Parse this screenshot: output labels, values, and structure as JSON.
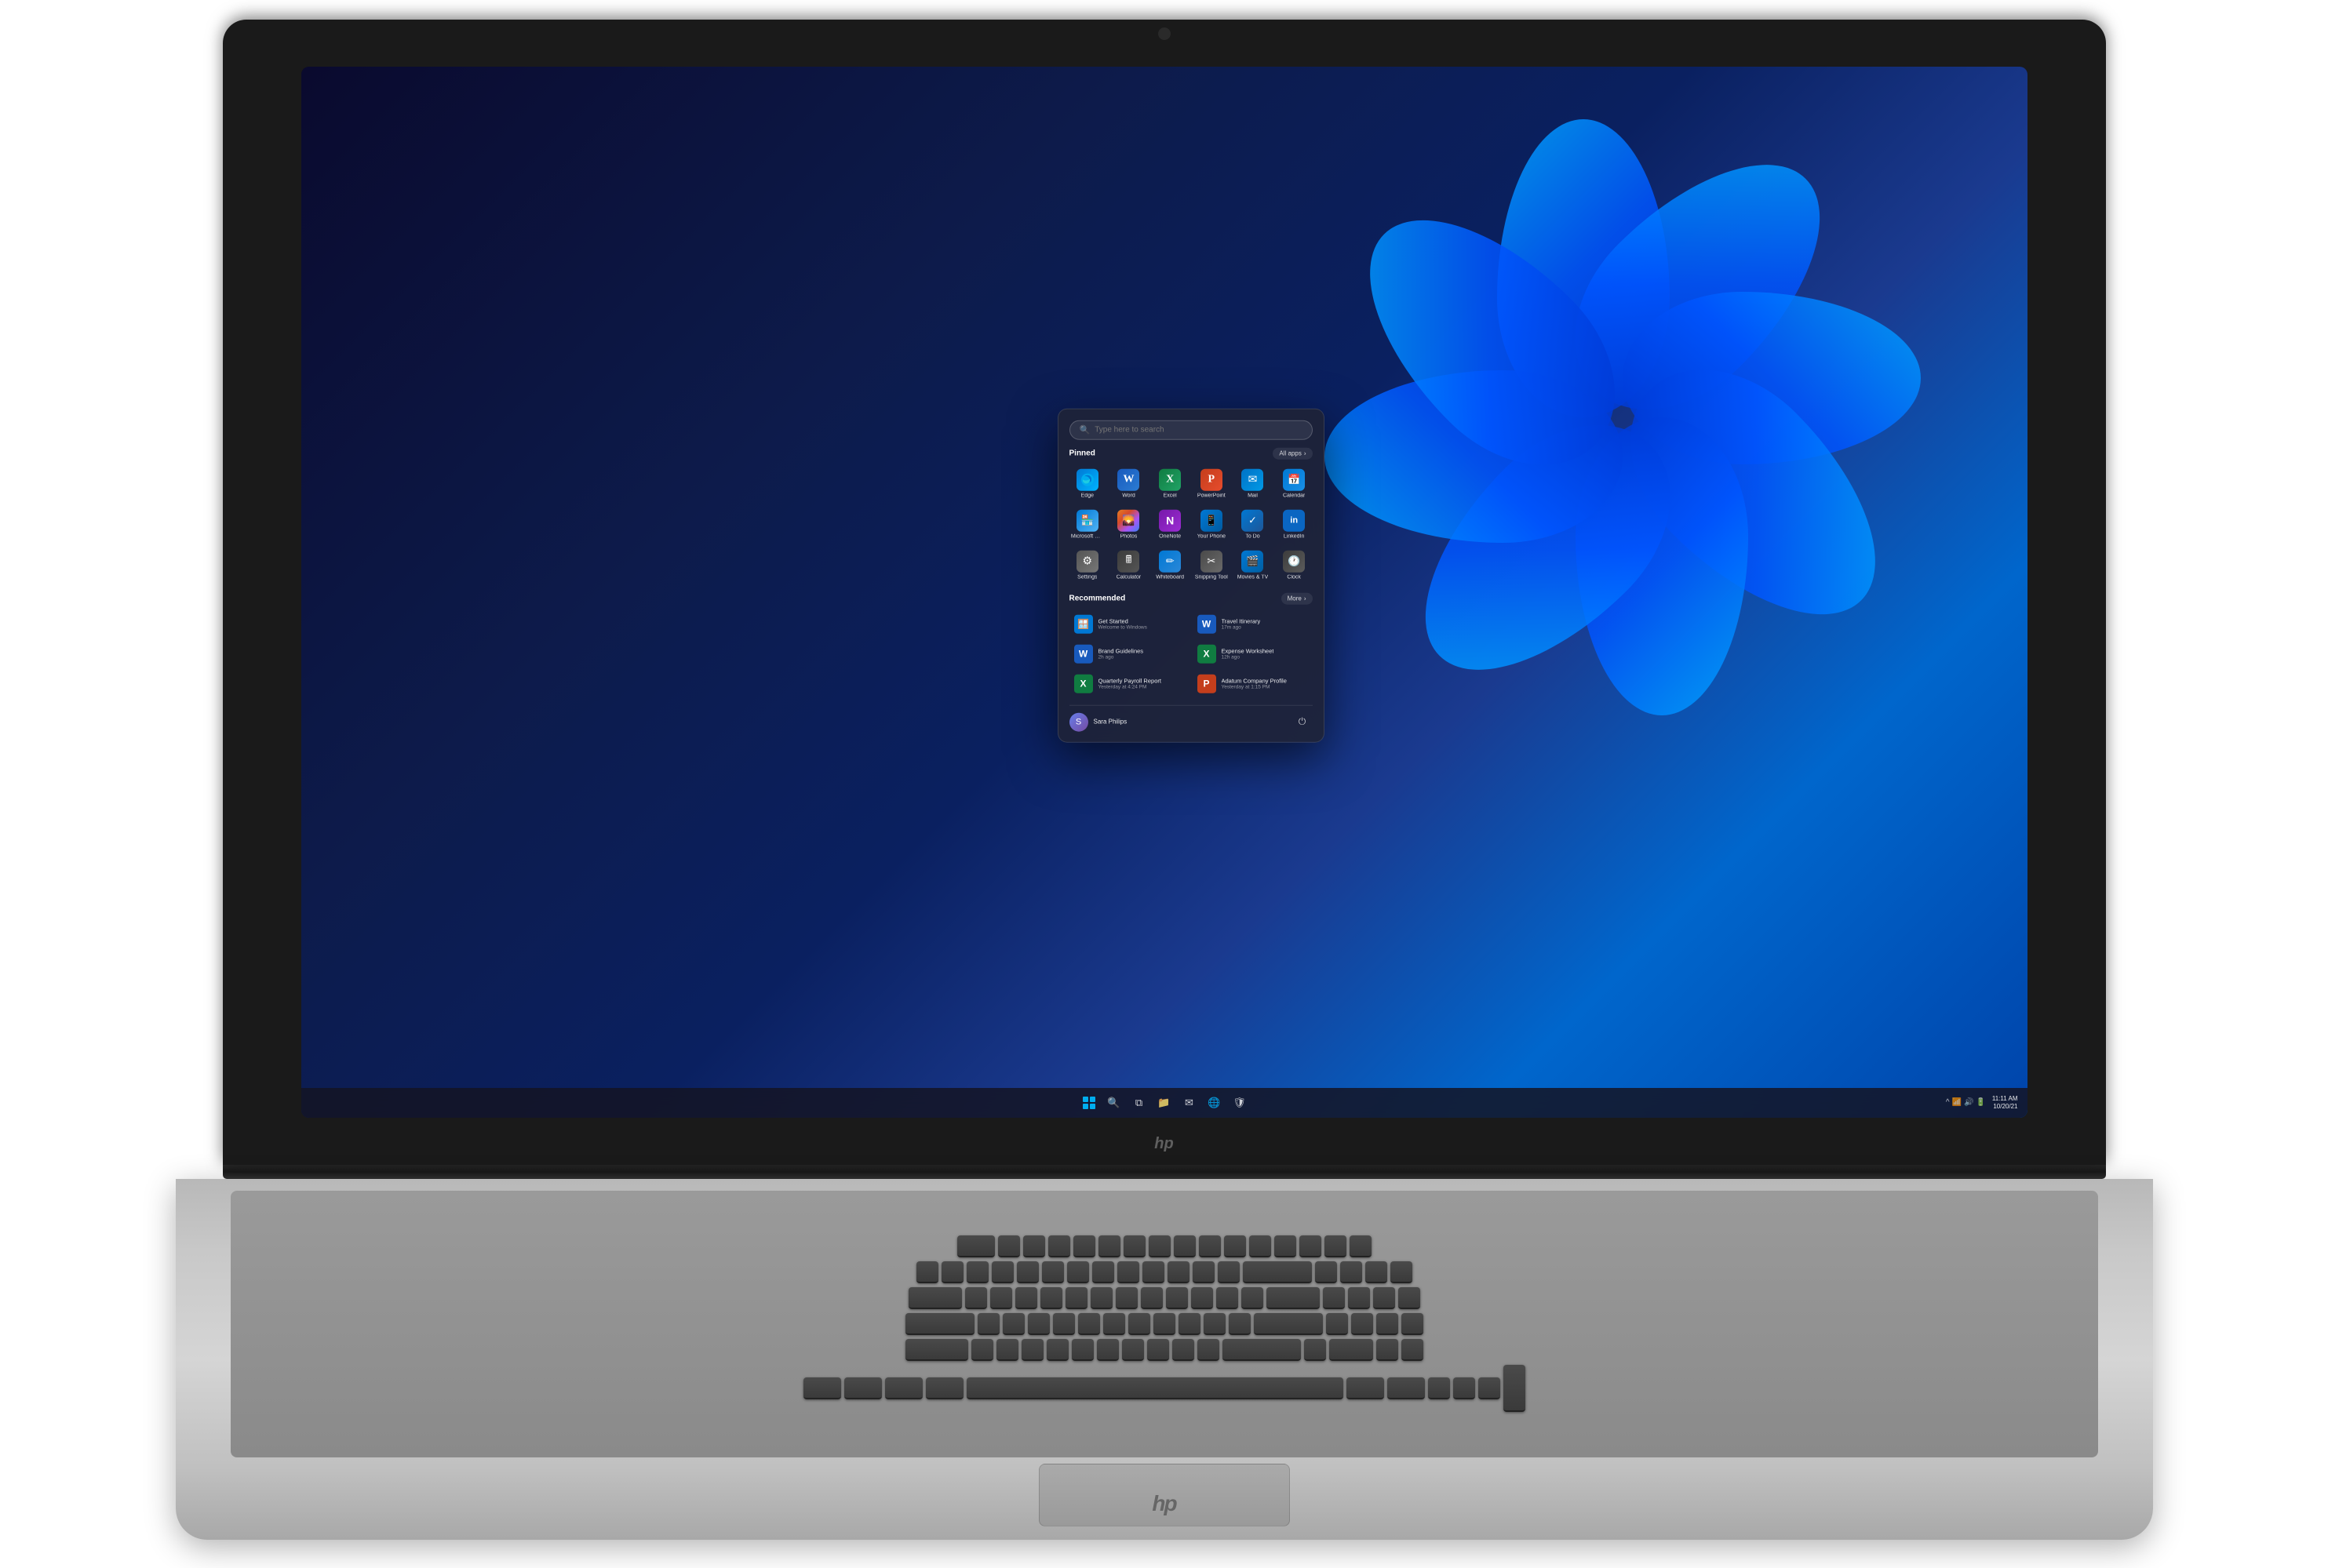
{
  "laptop": {
    "brand": "hp"
  },
  "search": {
    "placeholder": "Type here to search"
  },
  "startmenu": {
    "pinned_label": "Pinned",
    "allapps_label": "All apps",
    "recommended_label": "Recommended",
    "more_label": "More",
    "pinned_apps": [
      {
        "id": "edge",
        "label": "Edge",
        "emoji": "🌐",
        "color_class": "edge-icon"
      },
      {
        "id": "word",
        "label": "Word",
        "emoji": "W",
        "color_class": "word-icon"
      },
      {
        "id": "excel",
        "label": "Excel",
        "emoji": "X",
        "color_class": "excel-icon"
      },
      {
        "id": "powerpoint",
        "label": "PowerPoint",
        "emoji": "P",
        "color_class": "ppt-icon"
      },
      {
        "id": "mail",
        "label": "Mail",
        "emoji": "✉",
        "color_class": "mail-icon"
      },
      {
        "id": "calendar",
        "label": "Calendar",
        "emoji": "📅",
        "color_class": "calendar-icon"
      },
      {
        "id": "microsoft-store",
        "label": "Microsoft Store",
        "emoji": "🏪",
        "color_class": "msstore-icon"
      },
      {
        "id": "photos",
        "label": "Photos",
        "emoji": "🖼",
        "color_class": "photos-icon"
      },
      {
        "id": "onenote",
        "label": "OneNote",
        "emoji": "N",
        "color_class": "onenote-icon"
      },
      {
        "id": "your-phone",
        "label": "Your Phone",
        "emoji": "📱",
        "color_class": "yourphone-icon"
      },
      {
        "id": "todo",
        "label": "To Do",
        "emoji": "✓",
        "color_class": "todo-icon"
      },
      {
        "id": "linkedin",
        "label": "LinkedIn",
        "emoji": "in",
        "color_class": "linkedin-icon"
      },
      {
        "id": "settings",
        "label": "Settings",
        "emoji": "⚙",
        "color_class": "settings-icon"
      },
      {
        "id": "calculator",
        "label": "Calculator",
        "emoji": "🖩",
        "color_class": "calculator-icon"
      },
      {
        "id": "whiteboard",
        "label": "Whiteboard",
        "emoji": "✏",
        "color_class": "whiteboard-icon"
      },
      {
        "id": "snipping-tool",
        "label": "Snipping Tool",
        "emoji": "✂",
        "color_class": "snipping-icon"
      },
      {
        "id": "movies-tv",
        "label": "Movies & TV",
        "emoji": "🎬",
        "color_class": "movies-icon"
      },
      {
        "id": "clock",
        "label": "Clock",
        "emoji": "🕐",
        "color_class": "clock-icon"
      }
    ],
    "recommended_items": [
      {
        "id": "get-started",
        "label": "Get Started",
        "subtitle": "Welcome to Windows",
        "time": "",
        "emoji": "🪟",
        "color": "#0078d4"
      },
      {
        "id": "travel-itinerary",
        "label": "Travel Itinerary",
        "subtitle": "",
        "time": "17m ago",
        "emoji": "W",
        "color": "#185abd"
      },
      {
        "id": "brand-guidelines",
        "label": "Brand Guidelines",
        "subtitle": "",
        "time": "2h ago",
        "emoji": "W",
        "color": "#185abd"
      },
      {
        "id": "expense-worksheet",
        "label": "Expense Worksheet",
        "subtitle": "",
        "time": "12h ago",
        "emoji": "X",
        "color": "#107c41"
      },
      {
        "id": "quarterly-payroll",
        "label": "Quarterly Payroll Report",
        "subtitle": "",
        "time": "Yesterday at 4:24 PM",
        "emoji": "X",
        "color": "#107c41"
      },
      {
        "id": "adatum-company",
        "label": "Adatum Company Profile",
        "subtitle": "",
        "time": "Yesterday at 1:15 PM",
        "emoji": "P",
        "color": "#c43e1c"
      }
    ],
    "user": {
      "name": "Sara Philips",
      "initials": "S"
    },
    "power_label": "⏻"
  },
  "taskbar": {
    "icons": [
      "⊞",
      "🔍",
      "📁",
      "✉",
      "🌐",
      "🛡"
    ],
    "time": "11:11 AM",
    "date": "10/20/21"
  }
}
